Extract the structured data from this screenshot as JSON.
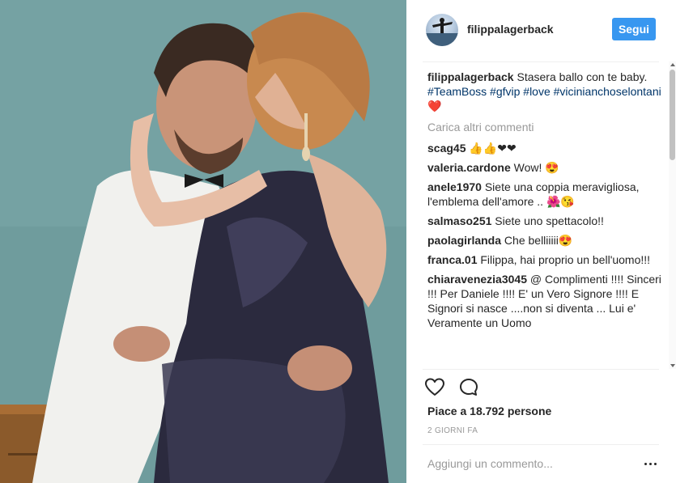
{
  "post": {
    "username": "filippalagerback",
    "follow_label": "Segui",
    "caption": {
      "user": "filippalagerback",
      "text": "Stasera ballo con te baby.",
      "hashtags": "#TeamBoss #gfvip #love #vicinianchoselontani",
      "heart": "❤️"
    },
    "load_more_label": "Carica altri commenti",
    "comments": [
      {
        "user": "scag45",
        "text": "👍👍❤❤"
      },
      {
        "user": "valeria.cardone",
        "text": "Wow! 😍"
      },
      {
        "user": "anele1970",
        "text": "Siete una coppia meravigliosa, l'emblema dell'amore .. 🌺😘"
      },
      {
        "user": "salmaso251",
        "text": "Siete uno spettacolo!!"
      },
      {
        "user": "paolagirlanda",
        "text": "Che belliiiii😍"
      },
      {
        "user": "franca.01",
        "text": "Filippa, hai proprio un bell'uomo!!!"
      },
      {
        "user": "chiaravenezia3045",
        "text": "@ Complimenti !!!! Sinceri !!! Per Daniele !!!! E' un Vero Signore !!!! E Signori si nasce ....non si diventa ... Lui e' Veramente un Uomo"
      }
    ],
    "likes_text": "Piace a 18.792 persone",
    "time_label": "2 GIORNI FA",
    "add_comment_placeholder": "Aggiungi un commento..."
  },
  "icons": {
    "like": "heart-outline-icon",
    "comment": "speech-bubble-icon",
    "more": "ellipsis-icon"
  },
  "colors": {
    "follow": "#3897f0",
    "hashtag": "#003569",
    "muted": "#999999"
  }
}
